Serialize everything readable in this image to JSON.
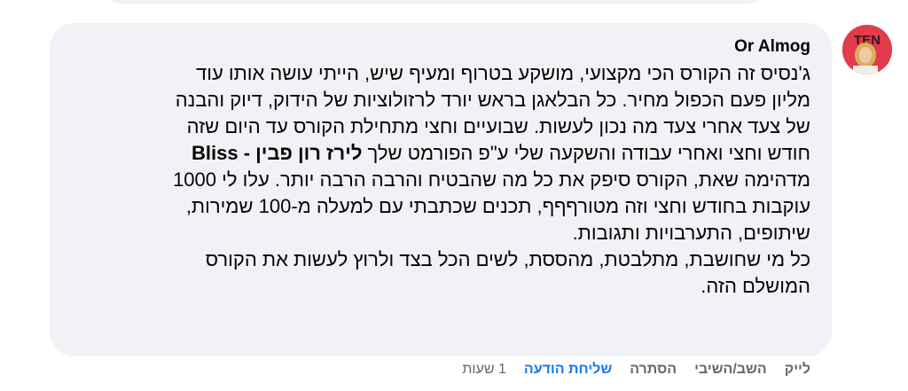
{
  "comment": {
    "author": "Or Almog",
    "lines": [
      "ג'נסיס זה הקורס הכי מקצועי, מושקע בטרוף ומעיף שיש, הייתי עושה אותו עוד",
      "מליון פעם הכפול מחיר. כל הבלאגן בראש יורד לרזולוציות של הידוק, דיוק והבנה",
      "של צעד אחרי צעד מה נכון לעשות. שבועיים וחצי מתחילת הקורס עד היום שזה",
      {
        "before": "חודש וחצי ואחרי עבודה והשקעה שלי ע\"פ הפורמט שלך ",
        "bold": "לירז רון פבין - Bliss"
      },
      "מדהימה שאת, הקורס סיפק את כל מה שהבטיח והרבה הרבה יותר. עלו לי 1000",
      "עוקבות בחודש וחצי וזה מטורףףף, תכנים שכתבתי עם למעלה מ-100 שמירות,",
      "שיתופים, התערבויות ותגובות.",
      "כל מי שחושבת, מתלבטת, מהססת, לשים הכל בצד ולרוץ לעשות את הקורס",
      "המושלם הזה."
    ]
  },
  "avatar": {
    "label": "TEN",
    "colors": {
      "bg": "#e23b4c",
      "hair": "#d9b15b",
      "skin": "#f1c9a8"
    }
  },
  "actions": {
    "like": "לייק",
    "reply": "השב/השיבי",
    "hide": "הסתרה",
    "send_message": "שליחת הודעה",
    "time": "1 שעות"
  },
  "colors": {
    "bubble_bg": "#f0f2f5",
    "text": "#050505",
    "muted": "#65676b",
    "accent": "#1877f2"
  }
}
